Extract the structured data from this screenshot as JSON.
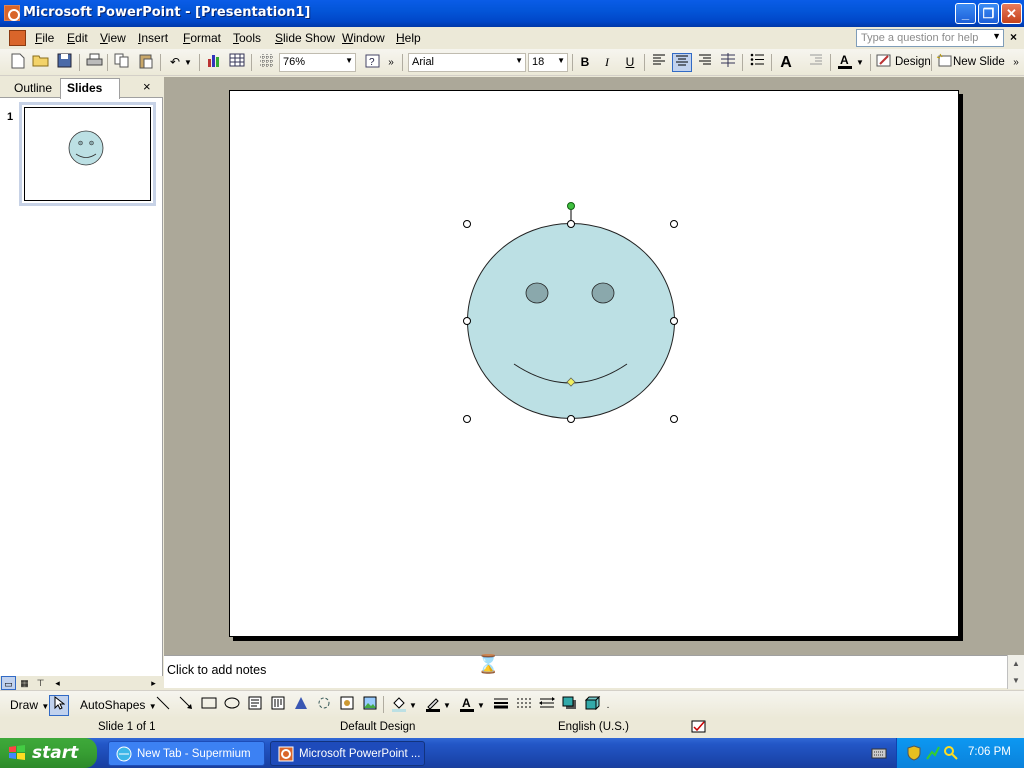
{
  "window": {
    "title": "Microsoft PowerPoint - [Presentation1]",
    "min": "_",
    "restore": "❐",
    "close": "✕"
  },
  "menu": {
    "items": [
      "File",
      "Edit",
      "View",
      "Insert",
      "Format",
      "Tools",
      "Slide Show",
      "Window",
      "Help"
    ],
    "help_placeholder": "Type a question for help",
    "close_doc": "×"
  },
  "toolbar": {
    "zoom": "76%",
    "font": "Arial",
    "font_size": "18",
    "bold": "B",
    "italic": "I",
    "underline": "U",
    "design": "Design",
    "new_slide": "New Slide"
  },
  "panel": {
    "tab_outline": "Outline",
    "tab_slides": "Slides",
    "close": "×",
    "slide_number": "1"
  },
  "notes": {
    "placeholder": "Click to add notes"
  },
  "drawing": {
    "draw": "Draw",
    "autoshapes": "AutoShapes"
  },
  "status": {
    "slide": "Slide 1 of 1",
    "design": "Default Design",
    "language": "English (U.S.)"
  },
  "taskbar": {
    "start": "start",
    "tasks": [
      "New Tab - Supermium",
      "Microsoft PowerPoint ..."
    ],
    "clock": "7:06 PM"
  },
  "colors": {
    "face_fill": "#bce0e4",
    "eye_fill": "#8aa8ac",
    "handle_rotate": "#40c040",
    "handle_adjust": "#f0f060"
  }
}
